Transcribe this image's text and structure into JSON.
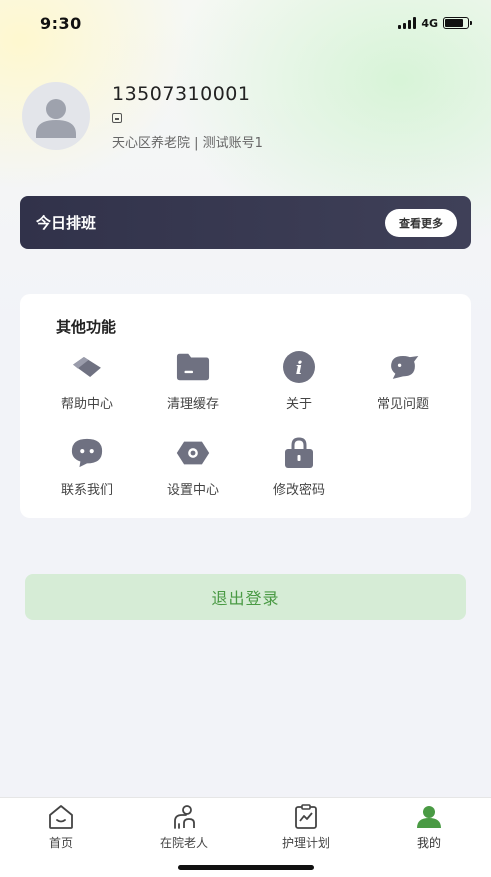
{
  "status_bar": {
    "time": "9:30",
    "network": "4G"
  },
  "profile": {
    "phone": "13507310001",
    "org": "天心区养老院 | 测试账号1"
  },
  "schedule": {
    "title": "今日排班",
    "more_label": "查看更多"
  },
  "functions": {
    "title": "其他功能",
    "items": [
      {
        "label": "帮助中心",
        "icon": "help-tag-icon"
      },
      {
        "label": "清理缓存",
        "icon": "folder-icon"
      },
      {
        "label": "关于",
        "icon": "info-icon"
      },
      {
        "label": "常见问题",
        "icon": "faq-chat-icon"
      },
      {
        "label": "联系我们",
        "icon": "chat-bubble-icon"
      },
      {
        "label": "设置中心",
        "icon": "settings-hex-icon"
      },
      {
        "label": "修改密码",
        "icon": "lock-icon"
      }
    ]
  },
  "logout_label": "退出登录",
  "tabbar": {
    "items": [
      {
        "label": "首页",
        "icon": "home-icon"
      },
      {
        "label": "在院老人",
        "icon": "elderly-icon"
      },
      {
        "label": "护理计划",
        "icon": "clipboard-chart-icon"
      },
      {
        "label": "我的",
        "icon": "user-icon",
        "active": true
      }
    ]
  },
  "colors": {
    "accent_green": "#4a9a44",
    "icon_gray": "#6f7181",
    "banner_dark": "#31324a",
    "logout_bg": "#d6ecd6"
  }
}
